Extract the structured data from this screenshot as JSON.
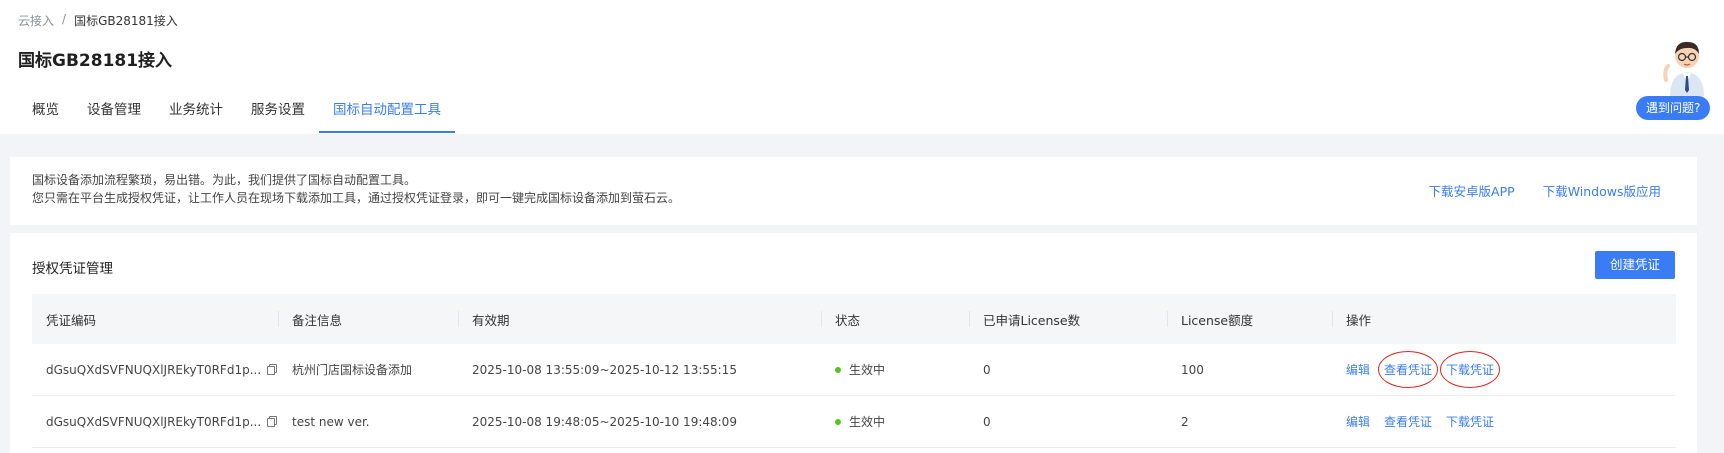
{
  "breadcrumb": {
    "parent": "云接入",
    "sep": "/",
    "current": "国标GB28181接入"
  },
  "page_title": "国标GB28181接入",
  "tabs": [
    {
      "label": "概览"
    },
    {
      "label": "设备管理"
    },
    {
      "label": "业务统计"
    },
    {
      "label": "服务设置"
    },
    {
      "label": "国标自动配置工具",
      "active": true
    }
  ],
  "helper": {
    "label": "遇到问题?"
  },
  "notice": {
    "line1": "国标设备添加流程繁琐，易出错。为此，我们提供了国标自动配置工具。",
    "line2": "您只需在平台生成授权凭证，让工作人员在现场下载添加工具，通过授权凭证登录，即可一键完成国标设备添加到萤石云。",
    "link_android": "下载安卓版APP",
    "link_windows": "下载Windows版应用"
  },
  "card": {
    "title": "授权凭证管理",
    "create_label": "创建凭证"
  },
  "table": {
    "headers": [
      "凭证编码",
      "备注信息",
      "有效期",
      "状态",
      "已申请License数",
      "License额度",
      "操作"
    ],
    "rows": [
      {
        "code": "dGsuQXdSVFNUQXlJREkyT0RFd1p...",
        "remark": "杭州门店国标设备添加",
        "validity": "2025-10-08 13:55:09~2025-10-12 13:55:15",
        "status": "生效中",
        "applied": "0",
        "quota": "100",
        "op_edit": "编辑",
        "op_view": "查看凭证",
        "op_download": "下载凭证"
      },
      {
        "code": "dGsuQXdSVFNUQXlJREkyT0RFd1p...",
        "remark": "test new ver.",
        "validity": "2025-10-08 19:48:05~2025-10-10 19:48:09",
        "status": "生效中",
        "applied": "0",
        "quota": "2",
        "op_edit": "编辑",
        "op_view": "查看凭证",
        "op_download": "下载凭证"
      }
    ]
  },
  "colors": {
    "accent": "#3a7cf5",
    "status_active": "#52c41a",
    "annotation": "#e0261c"
  }
}
